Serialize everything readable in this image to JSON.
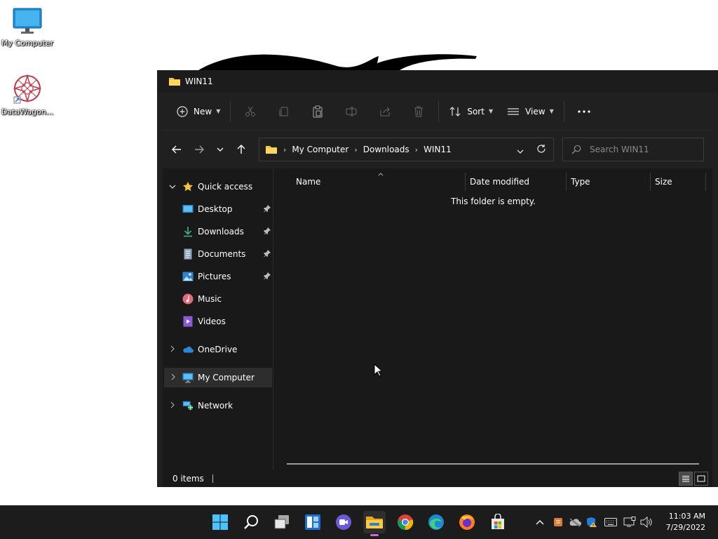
{
  "desktop": {
    "icons": [
      {
        "label": "My Computer"
      },
      {
        "label": "DataWagon..."
      }
    ]
  },
  "window": {
    "title": "WIN11",
    "toolbar": {
      "new_label": "New",
      "sort_label": "Sort",
      "view_label": "View"
    },
    "address": {
      "crumbs": [
        "My Computer",
        "Downloads",
        "WIN11"
      ]
    },
    "search": {
      "placeholder": "Search WIN11"
    },
    "nav": {
      "quick_access": "Quick access",
      "items": [
        {
          "label": "Desktop",
          "icon": "desktop-icon",
          "pinned": true
        },
        {
          "label": "Downloads",
          "icon": "download-icon",
          "pinned": true
        },
        {
          "label": "Documents",
          "icon": "document-icon",
          "pinned": true
        },
        {
          "label": "Pictures",
          "icon": "pictures-icon",
          "pinned": true
        },
        {
          "label": "Music",
          "icon": "music-icon",
          "pinned": false
        },
        {
          "label": "Videos",
          "icon": "videos-icon",
          "pinned": false
        }
      ],
      "onedrive": "OneDrive",
      "my_computer": "My Computer",
      "network": "Network"
    },
    "columns": [
      "Name",
      "Date modified",
      "Type",
      "Size"
    ],
    "empty_message": "This folder is empty.",
    "status": {
      "item_count": "0 items"
    }
  },
  "taskbar": {
    "clock_time": "11:03 AM",
    "clock_date": "7/29/2022"
  },
  "colors": {
    "folder_yellow": "#f4c542",
    "window_bg": "#191919",
    "taskbar_bg": "#1c1c1c",
    "accent_blue": "#4cc2ff"
  }
}
